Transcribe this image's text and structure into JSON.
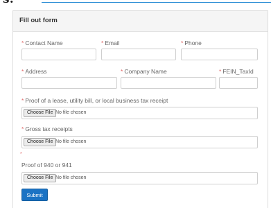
{
  "page": {
    "heading_fragment": "s:"
  },
  "form": {
    "title": "Fill out form",
    "required_marker": "*",
    "fields": {
      "contact_name": {
        "label": "Contact Name",
        "value": ""
      },
      "email": {
        "label": "Email",
        "value": ""
      },
      "phone": {
        "label": "Phone",
        "value": ""
      },
      "address": {
        "label": "Address",
        "value": ""
      },
      "company_name": {
        "label": "Company Name",
        "value": ""
      },
      "fein": {
        "label": "FEIN_TaxId",
        "value": ""
      }
    },
    "uploads": {
      "lease": {
        "label": "Proof of a lease, utility bill, or local business tax receipt",
        "button": "Choose File",
        "status": "No file chosen"
      },
      "gross": {
        "label": "Gross tax receipts",
        "button": "Choose File",
        "status": "No file chosen"
      },
      "form940": {
        "label": "Proof of 940 or 941",
        "button": "Choose File",
        "status": "No file chosen"
      }
    },
    "submit_label": "Submit"
  },
  "colors": {
    "accent": "#1b73c4",
    "required": "#e06666",
    "top_rule": "#2f8fd6"
  }
}
